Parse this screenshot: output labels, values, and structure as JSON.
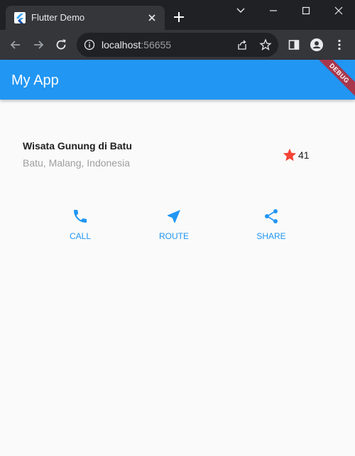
{
  "browser": {
    "tab_title": "Flutter Demo",
    "url_host": "localhost",
    "url_port": ":56655"
  },
  "app": {
    "title": "My App",
    "debug_banner": "DEBUG",
    "accent_color": "#2196f3"
  },
  "place": {
    "name": "Wisata Gunung di Batu",
    "location": "Batu, Malang, Indonesia",
    "star_count": "41",
    "star_color": "#f44336"
  },
  "actions": [
    {
      "label": "CALL",
      "icon": "phone-icon"
    },
    {
      "label": "ROUTE",
      "icon": "navigation-icon"
    },
    {
      "label": "SHARE",
      "icon": "share-icon"
    }
  ]
}
